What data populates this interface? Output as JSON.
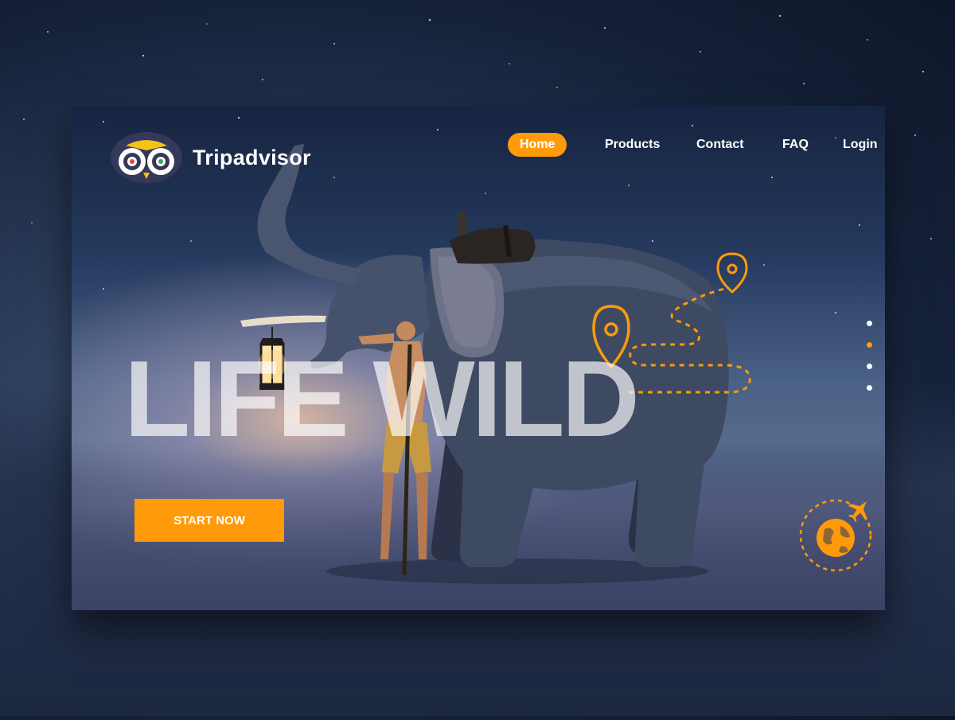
{
  "brand": {
    "name": "Tripadvisor",
    "accent": "#ff9a0b"
  },
  "nav": {
    "items": [
      {
        "label": "Home",
        "active": true
      },
      {
        "label": "Products",
        "active": false
      },
      {
        "label": "Contact",
        "active": false
      },
      {
        "label": "FAQ",
        "active": false
      },
      {
        "label": "Login",
        "active": false
      }
    ]
  },
  "hero": {
    "title": "LIFE WILD",
    "cta_label": "START NOW"
  },
  "slider": {
    "count": 4,
    "active_index": 1
  },
  "icons": [
    "owl-logo-icon",
    "location-pin-icon",
    "globe-plane-icon"
  ]
}
